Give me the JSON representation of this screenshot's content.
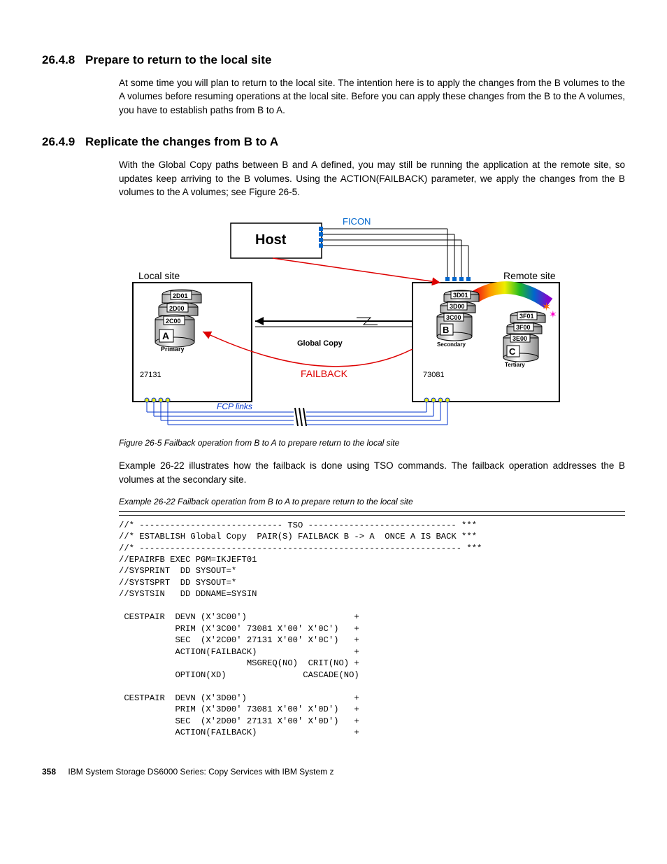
{
  "section1": {
    "num": "26.4.8",
    "title": "Prepare to return to the local site",
    "para": "At some time you will plan to return to the local site. The intention here is to apply the changes from the B volumes to the A volumes before resuming operations at the local site. Before you can apply these changes from the B to the A volumes, you have to establish paths from B to A."
  },
  "section2": {
    "num": "26.4.9",
    "title": "Replicate the changes from B to A",
    "para": "With the Global Copy paths between B and A defined, you may still be running the application at the remote site, so updates keep arriving to the B volumes. Using the ACTION(FAILBACK) parameter, we apply the changes from the B volumes to the A volumes; see Figure 26-5."
  },
  "figure": {
    "host": "Host",
    "ficon": "FICON",
    "localsite": "Local site",
    "remotesite": "Remote site",
    "globalcopy": "Global Copy",
    "failback": "FAILBACK",
    "fcplinks": "FCP links",
    "A": "A",
    "primary": "Primary",
    "localnum": "27131",
    "B": "B",
    "secondary": "Secondary",
    "remotenum": "73081",
    "C": "C",
    "tertiary": "Tertiary",
    "vols_local": [
      "2D01",
      "2D00",
      "2C00"
    ],
    "vols_remoteB": [
      "3D01",
      "3D00",
      "3C00"
    ],
    "vols_remoteC": [
      "3F01",
      "3F00",
      "3E00"
    ]
  },
  "figcaption": "Figure 26-5   Failback operation from B to A to prepare return to the local site",
  "para_after_fig": "Example 26-22 illustrates how the failback is done using TSO commands. The failback operation addresses the B volumes at the secondary site.",
  "example_caption": "Example 26-22   Failback operation from B to A to prepare return to the local site",
  "code": "//* ---------------------------- TSO ----------------------------- ***\n//* ESTABLISH Global Copy  PAIR(S) FAILBACK B -> A  ONCE A IS BACK ***\n//* --------------------------------------------------------------- ***\n//EPAIRFB EXEC PGM=IKJEFT01\n//SYSPRINT  DD SYSOUT=*\n//SYSTSPRT  DD SYSOUT=*\n//SYSTSIN   DD DDNAME=SYSIN\n\n CESTPAIR  DEVN (X'3C00')                     +\n           PRIM (X'3C00' 73081 X'00' X'0C')   +\n           SEC  (X'2C00' 27131 X'00' X'0C')   +\n           ACTION(FAILBACK)                   +\n                         MSGREQ(NO)  CRIT(NO) +\n           OPTION(XD)               CASCADE(NO)\n\n CESTPAIR  DEVN (X'3D00')                     +\n           PRIM (X'3D00' 73081 X'00' X'0D')   +\n           SEC  (X'2D00' 27131 X'00' X'0D')   +\n           ACTION(FAILBACK)                   +",
  "footer": {
    "page": "358",
    "book": "IBM System Storage DS6000 Series: Copy Services with IBM System z"
  }
}
